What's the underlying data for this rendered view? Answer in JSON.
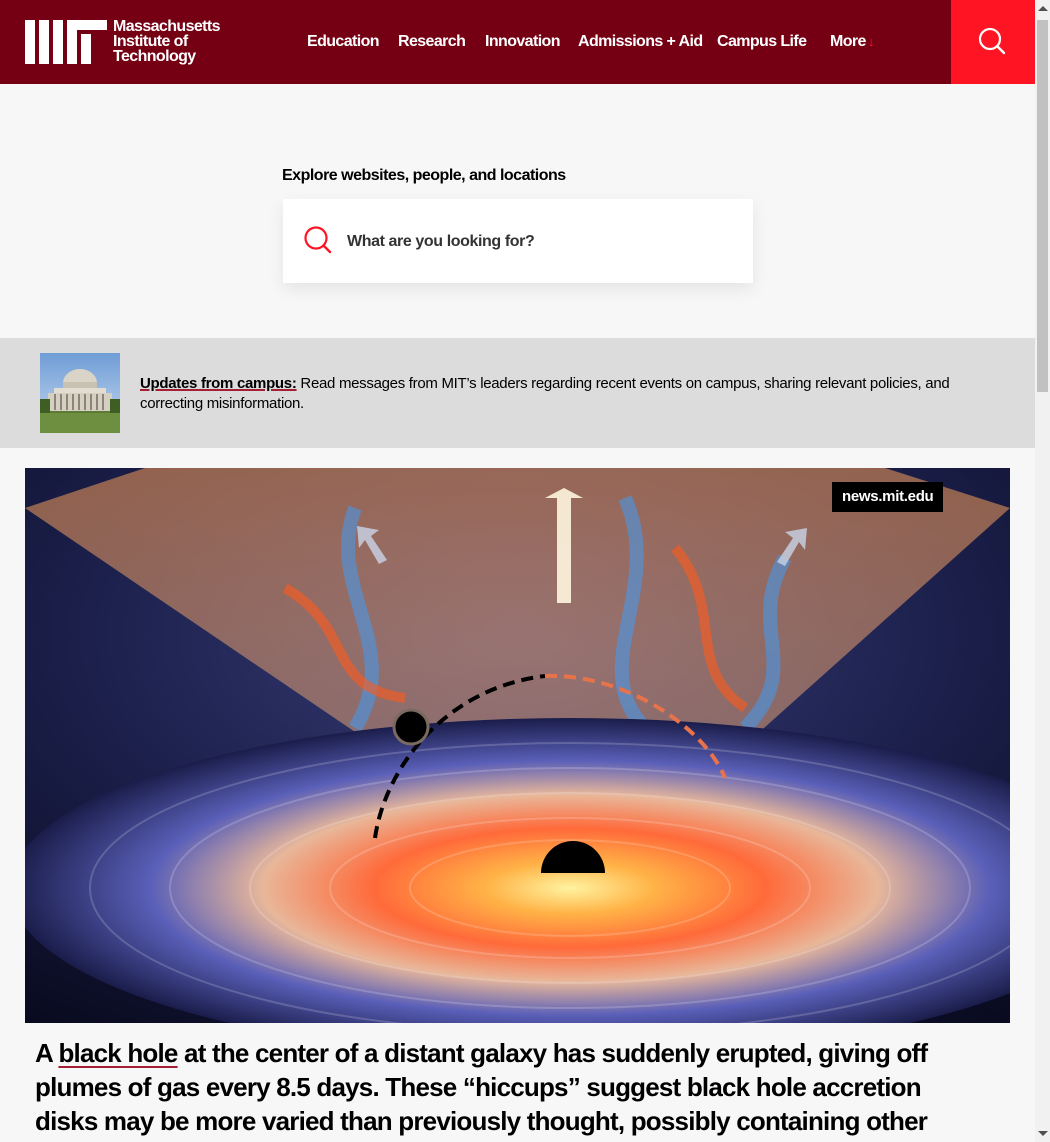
{
  "header": {
    "logo_lines": [
      "Massachusetts",
      "Institute of",
      "Technology"
    ],
    "nav": [
      {
        "label": "Education"
      },
      {
        "label": "Research"
      },
      {
        "label": "Innovation"
      },
      {
        "label": "Admissions + Aid"
      },
      {
        "label": "Campus Life"
      },
      {
        "label": "More",
        "arrow": "↓"
      }
    ],
    "brand_color": "#750014",
    "accent_color": "#ff1423"
  },
  "search": {
    "label": "Explore websites, people, and locations",
    "placeholder": "What are you looking for?"
  },
  "banner": {
    "link_text": "Updates from campus:",
    "text": " Read messages from MIT’s leaders regarding recent events on campus, sharing relevant policies, and correcting misinformation."
  },
  "hero": {
    "badge": "news.mit.edu"
  },
  "headline": {
    "prefix": "A ",
    "link_text": "black hole",
    "rest": " at the center of a distant galaxy has suddenly erupted, giving off plumes of gas every 8.5 days. These “hiccups” suggest black hole accretion disks may be more varied than previously thought, possibly containing other"
  }
}
